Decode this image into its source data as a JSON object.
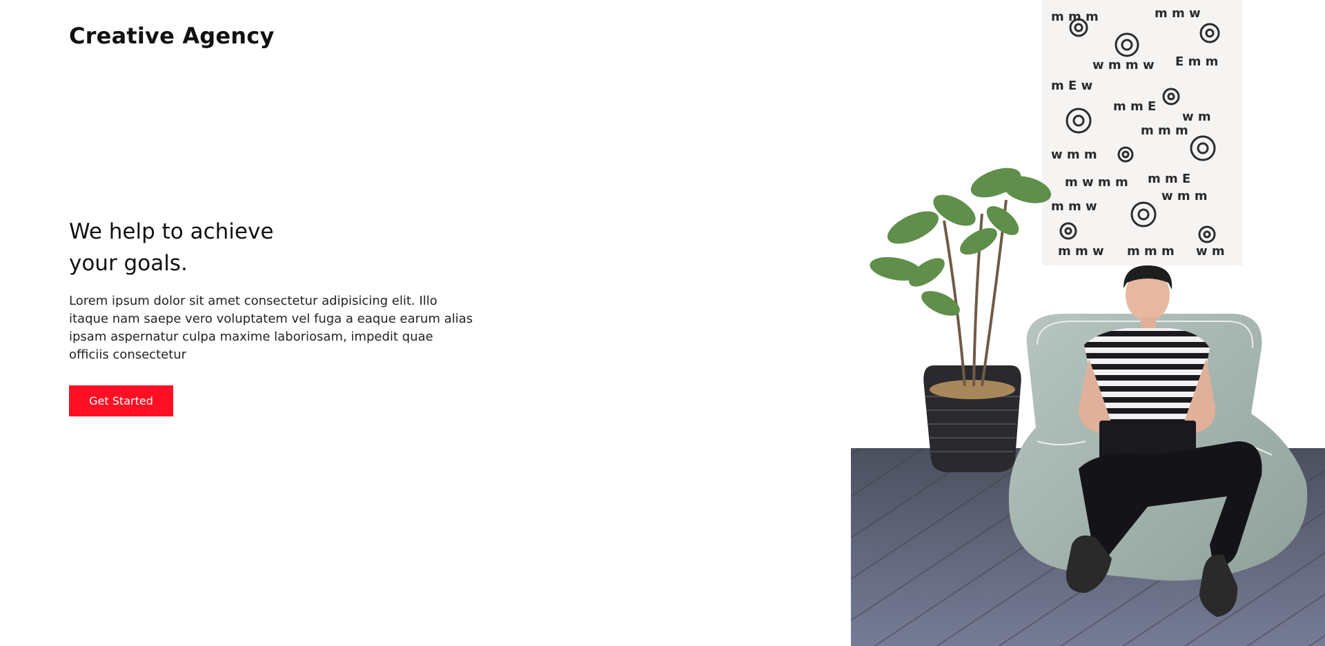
{
  "brand": "Creative Agency",
  "hero": {
    "title_line1": "We help to achieve",
    "title_line2": "your goals.",
    "description": "Lorem ipsum dolor sit amet consectetur adipisicing elit. Illo itaque nam saepe vero voluptatem vel fuga a eaque earum alias ipsam aspernatur culpa maxime laboriosam, impedit quae officiis consectetur",
    "cta_label": "Get Started"
  },
  "colors": {
    "accent": "#ff0f24",
    "text": "#111111"
  },
  "icons": {
    "menu": "hamburger-icon"
  },
  "image": {
    "subject": "man-with-laptop-on-beanbag"
  }
}
